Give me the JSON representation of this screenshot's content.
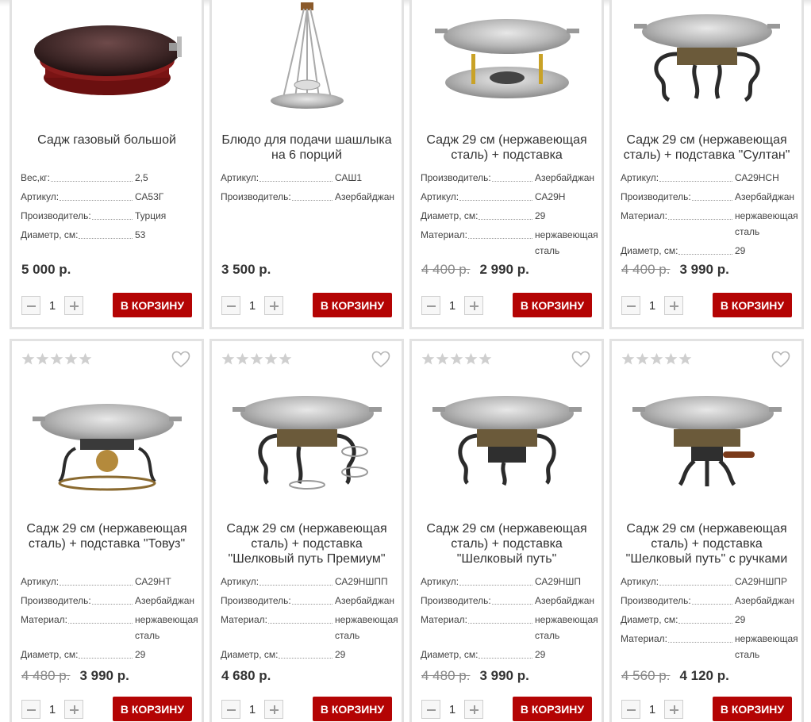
{
  "colors": {
    "accent": "#b40404",
    "border": "#e2e2e2",
    "star": "#cfcfcf"
  },
  "icons": {
    "rating": "star-icon",
    "wishlist": "heart-icon",
    "minus": "minus-icon",
    "plus": "plus-icon"
  },
  "cart_label": "В КОРЗИНУ",
  "products": [
    {
      "title": "Садж газовый большой",
      "props": [
        {
          "name": "Вес,кг:",
          "value": "2,5"
        },
        {
          "name": "Артикул:",
          "value": "СА53Г"
        },
        {
          "name": "Производитель:",
          "value": "Турция"
        },
        {
          "name": "Диаметр, см:",
          "value": "53"
        }
      ],
      "old_price": "",
      "price": "5 000 р.",
      "qty": "1"
    },
    {
      "title": "Блюдо для подачи шашлыка на 6 порций",
      "props": [
        {
          "name": "Артикул:",
          "value": "САШ1"
        },
        {
          "name": "Производитель:",
          "value": "Азербайджан"
        }
      ],
      "old_price": "",
      "price": "3 500 р.",
      "qty": "1"
    },
    {
      "title": "Садж 29 см (нержавеющая сталь) + подставка",
      "props": [
        {
          "name": "Производитель:",
          "value": "Азербайджан"
        },
        {
          "name": "Артикул:",
          "value": "СА29Н"
        },
        {
          "name": "Диаметр, см:",
          "value": "29"
        },
        {
          "name": "Материал:",
          "value": "нержавеющая сталь"
        }
      ],
      "old_price": "4 400 р.",
      "price": "2 990 р.",
      "qty": "1"
    },
    {
      "title": "Садж 29 см (нержавеющая сталь) + подставка \"Султан\"",
      "props": [
        {
          "name": "Артикул:",
          "value": "СА29НСН"
        },
        {
          "name": "Производитель:",
          "value": "Азербайджан"
        },
        {
          "name": "Материал:",
          "value": "нержавеющая сталь"
        },
        {
          "name": "Диаметр, см:",
          "value": "29"
        }
      ],
      "old_price": "4 400 р.",
      "price": "3 990 р.",
      "qty": "1"
    },
    {
      "title": "Садж 29 см (нержавеющая сталь) + подставка \"Товуз\"",
      "props": [
        {
          "name": "Артикул:",
          "value": "СА29НТ"
        },
        {
          "name": "Производитель:",
          "value": "Азербайджан"
        },
        {
          "name": "Материал:",
          "value": "нержавеющая сталь"
        },
        {
          "name": "Диаметр, см:",
          "value": "29"
        }
      ],
      "old_price": "4 480 р.",
      "price": "3 990 р.",
      "qty": "1"
    },
    {
      "title": "Садж 29 см (нержавеющая сталь) + подставка \"Шелковый путь Премиум\"",
      "props": [
        {
          "name": "Артикул:",
          "value": "СА29НШПП"
        },
        {
          "name": "Производитель:",
          "value": "Азербайджан"
        },
        {
          "name": "Материал:",
          "value": "нержавеющая сталь"
        },
        {
          "name": "Диаметр, см:",
          "value": "29"
        }
      ],
      "old_price": "",
      "price": "4 680 р.",
      "qty": "1"
    },
    {
      "title": "Садж 29 см (нержавеющая сталь) + подставка \"Шелковый путь\"",
      "props": [
        {
          "name": "Артикул:",
          "value": "СА29НШП"
        },
        {
          "name": "Производитель:",
          "value": "Азербайджан"
        },
        {
          "name": "Материал:",
          "value": "нержавеющая сталь"
        },
        {
          "name": "Диаметр, см:",
          "value": "29"
        }
      ],
      "old_price": "4 480 р.",
      "price": "3 990 р.",
      "qty": "1"
    },
    {
      "title": "Садж 29 см (нержавеющая сталь) + подставка \"Шелковый путь\" с ручками",
      "props": [
        {
          "name": "Артикул:",
          "value": "СА29НШПР"
        },
        {
          "name": "Производитель:",
          "value": "Азербайджан"
        },
        {
          "name": "Диаметр, см:",
          "value": "29"
        },
        {
          "name": "Материал:",
          "value": "нержавеющая сталь"
        }
      ],
      "old_price": "4 560 р.",
      "price": "4 120 р.",
      "qty": "1"
    }
  ]
}
